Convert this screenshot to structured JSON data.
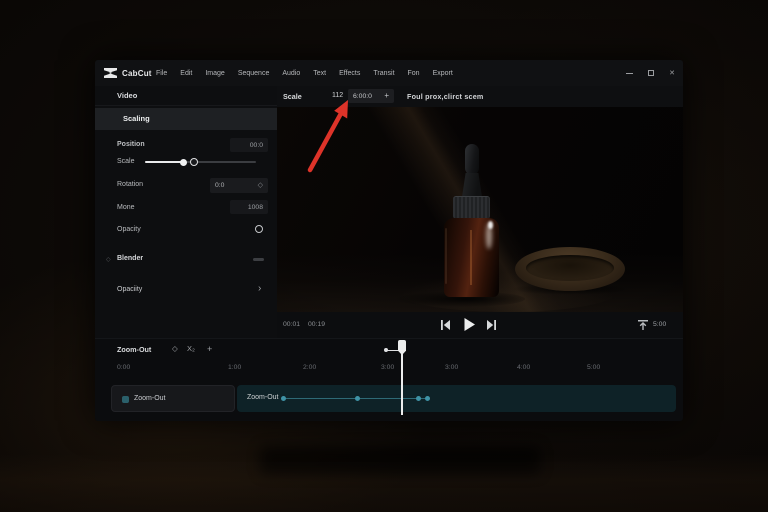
{
  "titlebar": {
    "app_name": "CabCut",
    "menu": [
      "File",
      "Edit",
      "Image",
      "Sequence",
      "Audio",
      "Text",
      "Effects",
      "Transit",
      "Fon",
      "Export"
    ]
  },
  "icons": {
    "close": "✕",
    "chevron_right": "›",
    "diamond": "◇",
    "plus": "+",
    "x2": "X₂"
  },
  "inspector": {
    "header": "Video",
    "section": "Scaling",
    "rows": {
      "position_label": "Position",
      "position_value": "00:0",
      "scale_label": "Scale",
      "rotation_label": "Rotation",
      "rotation_value": "0:0",
      "mone_label": "Mone",
      "mone_value": "1008",
      "opacity_label": "Opacity",
      "blender_label": "Blender",
      "opacity2_label": "Opaciity"
    }
  },
  "preview": {
    "scale_label": "Scale",
    "scale_value": "112",
    "timecode": "6:00:0",
    "plus": "+",
    "hint": "Foul prox,clirct scem",
    "current_time": "00:01",
    "duration": "00:19",
    "end_time": "5:00"
  },
  "timeline": {
    "tool_label": "Zoom-Out",
    "ruler": [
      "0:00",
      "1:00",
      "2:00",
      "3:00",
      "3:00",
      "4:00",
      "5:00"
    ],
    "clips": [
      {
        "label": "Zoom-Out"
      },
      {
        "label": "Zoom-Out"
      }
    ]
  },
  "colors": {
    "accent": "#3f93a6",
    "arrow": "#de3329",
    "clip_bg": "#0e2227"
  }
}
